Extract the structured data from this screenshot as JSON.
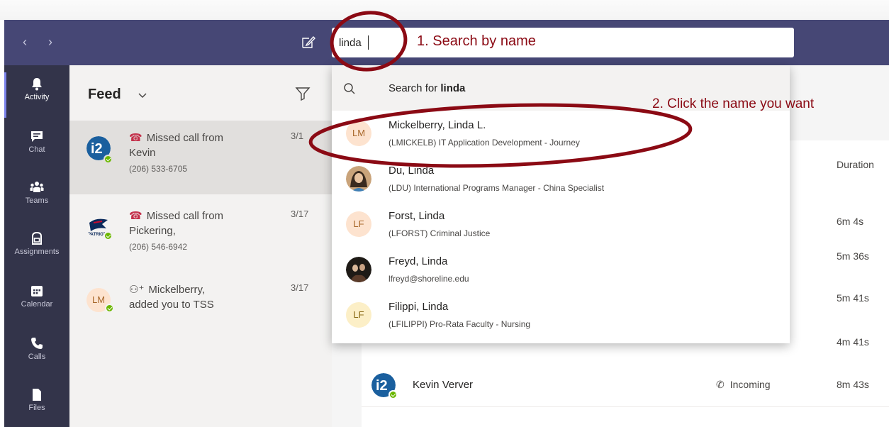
{
  "search": {
    "value": "linda",
    "placeholder": ""
  },
  "rail": {
    "items": [
      {
        "label": "Activity",
        "icon": "bell-icon",
        "active": true
      },
      {
        "label": "Chat",
        "icon": "chat-icon"
      },
      {
        "label": "Teams",
        "icon": "teams-icon"
      },
      {
        "label": "Assignments",
        "icon": "assignments-icon"
      },
      {
        "label": "Calendar",
        "icon": "calendar-icon"
      },
      {
        "label": "Calls",
        "icon": "phone-icon"
      },
      {
        "label": "Files",
        "icon": "file-icon"
      }
    ]
  },
  "feed": {
    "title": "Feed",
    "items": [
      {
        "line1": "Missed call from",
        "line2": "Kevin",
        "line3": "(206) 533-6705",
        "date": "3/1",
        "avatar": "i2-logo"
      },
      {
        "line1": "Missed call from",
        "line2": "Pickering,",
        "line3": "(206) 546-6942",
        "date": "3/17",
        "avatar": "patriots-logo"
      },
      {
        "line1": "Mickelberry,",
        "line2": "added you to TSS",
        "line3": "",
        "date": "3/17",
        "avatar_initials": "LM"
      }
    ]
  },
  "dropdown": {
    "search_prefix": "Search for ",
    "search_term": "linda",
    "results": [
      {
        "initials": "LM",
        "name": "Mickelberry, Linda L.",
        "sub": "(LMICKELB) IT Application Development - Journey"
      },
      {
        "initials": "",
        "name": "Du, Linda",
        "sub": "(LDU) International Programs Manager - China Specialist",
        "photo": true
      },
      {
        "initials": "LF",
        "name": "Forst, Linda",
        "sub": "(LFORST) Criminal Justice"
      },
      {
        "initials": "",
        "name": "Freyd, Linda",
        "sub": "lfreyd@shoreline.edu",
        "photo": true
      },
      {
        "initials": "LF",
        "name": "Filippi, Linda",
        "sub": "(LFILIPPI) Pro-Rata Faculty - Nursing"
      }
    ]
  },
  "calls": {
    "duration_header": "Duration",
    "durations": [
      "6m 4s",
      "5m 36s",
      "5m 41s",
      "4m 41s"
    ],
    "rows": [
      {
        "name": "Kevin Verver",
        "type": "Incoming",
        "duration": "8m 43s"
      }
    ]
  },
  "annotations": {
    "step1": "1. Search by name",
    "step2": "2. Click the name you want"
  },
  "colors": {
    "titlebar": "#464775",
    "rail": "#33344a",
    "annotation": "#8b0a14",
    "presence": "#6bb700"
  }
}
